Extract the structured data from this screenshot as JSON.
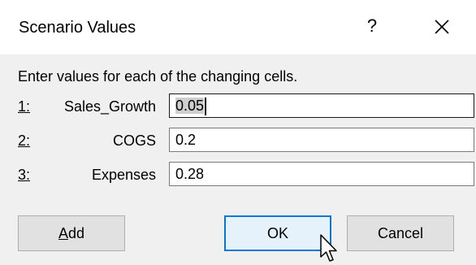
{
  "dialog": {
    "title": "Scenario Values",
    "help_glyph": "?",
    "instruction": "Enter values for each of the changing cells."
  },
  "rows": [
    {
      "number": "1:",
      "label": "Sales_Growth",
      "value": "0.05"
    },
    {
      "number": "2:",
      "label": "COGS",
      "value": "0.2"
    },
    {
      "number": "3:",
      "label": "Expenses",
      "value": "0.28"
    }
  ],
  "buttons": {
    "add": {
      "mnemonic": "A",
      "rest": "dd"
    },
    "ok": "OK",
    "cancel": "Cancel"
  },
  "icons": {
    "close": "close-icon",
    "help": "help-icon",
    "cursor": "mouse-pointer-icon"
  },
  "colors": {
    "default_button_border": "#0078d7",
    "default_button_fill": "#e5f1fb",
    "selection": "#cfcfcf"
  }
}
